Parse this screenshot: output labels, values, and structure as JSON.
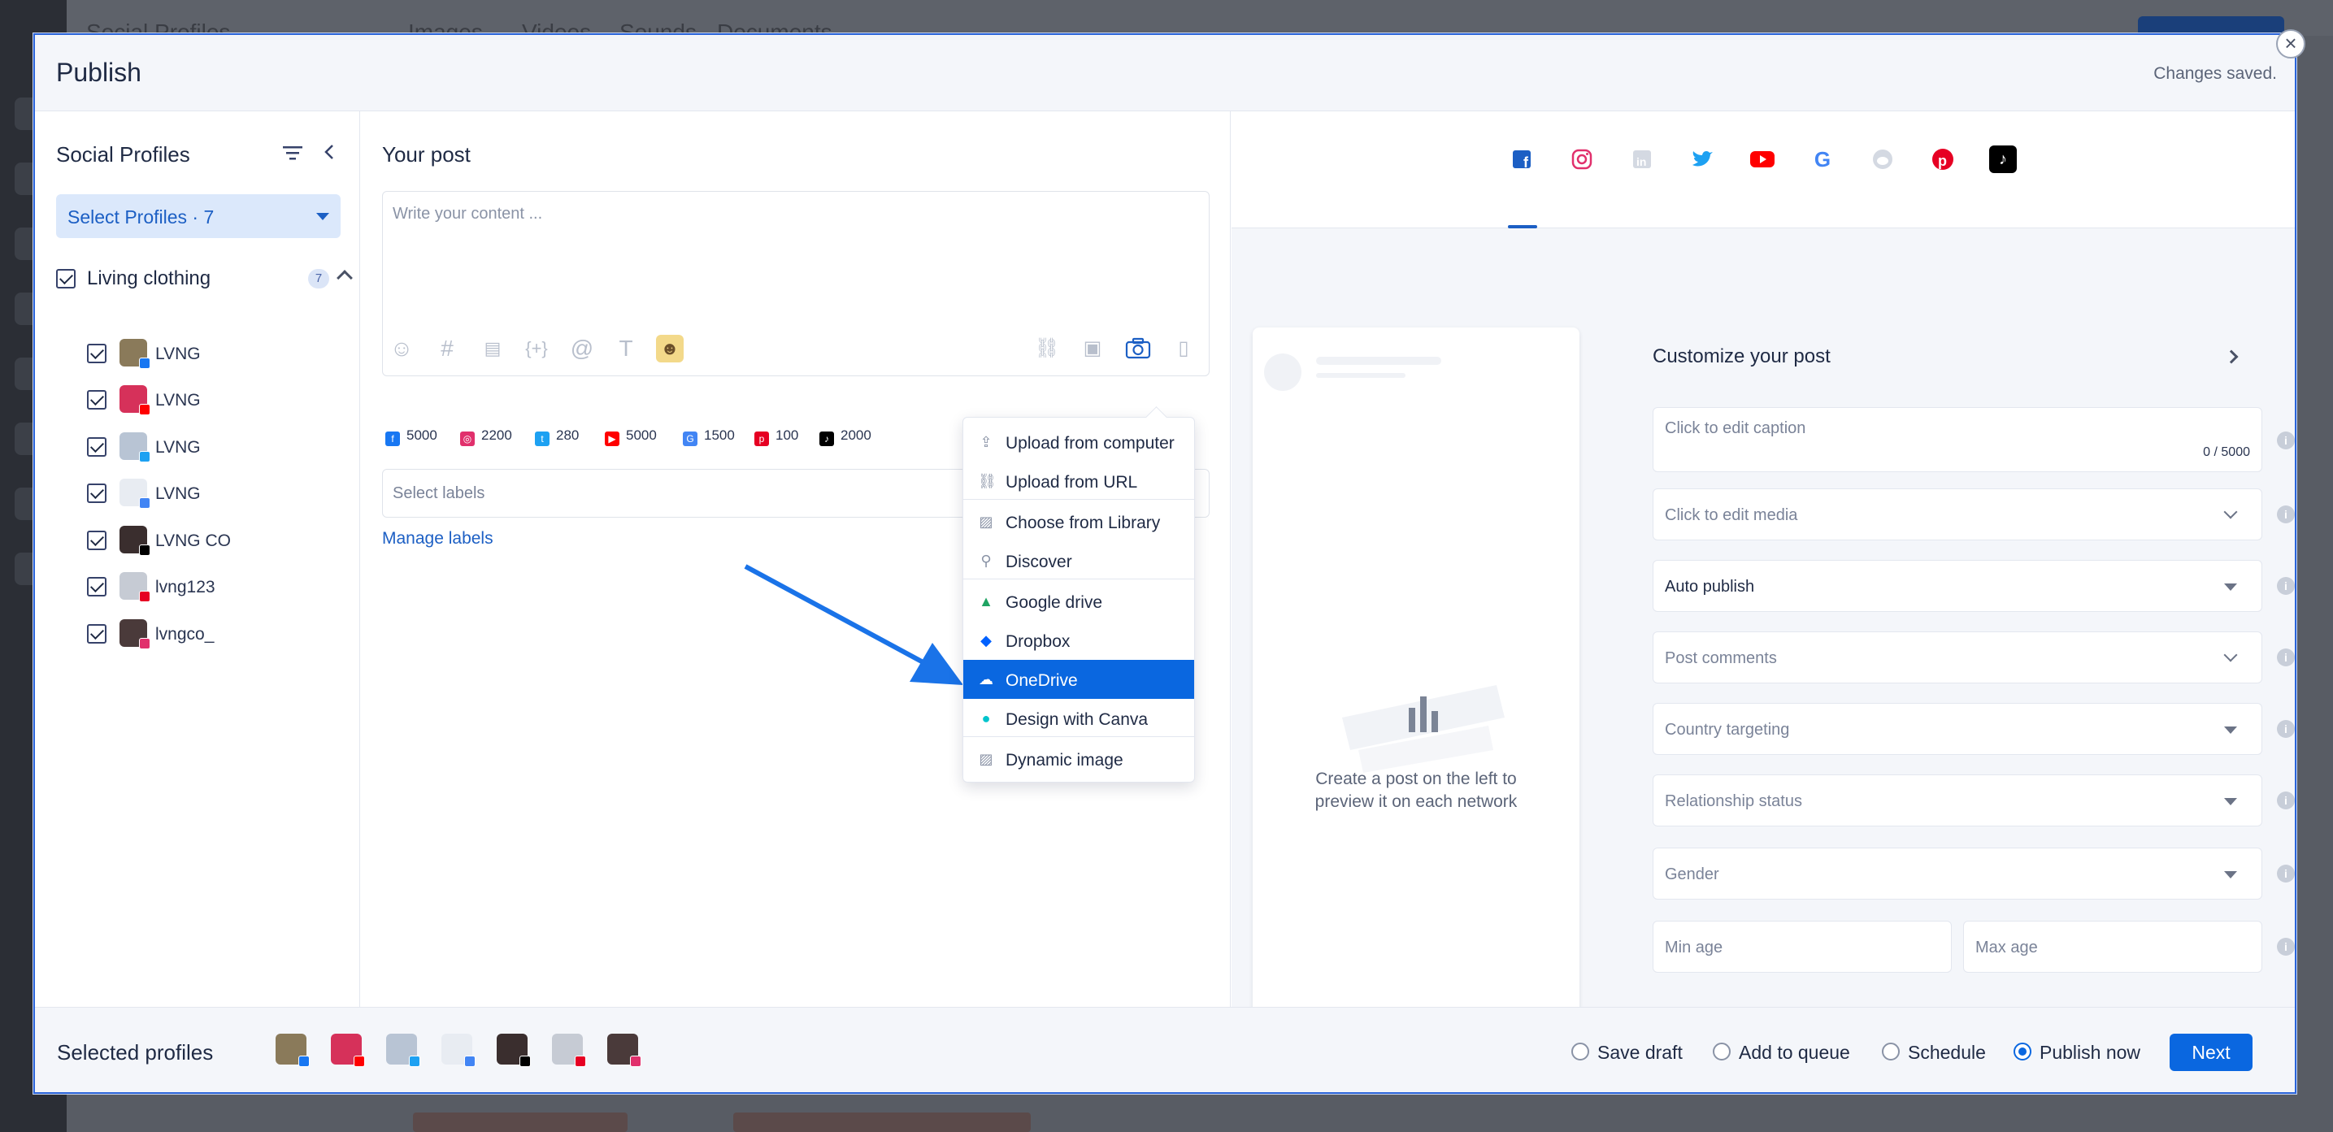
{
  "background": {
    "topbar_title": "Social Profiles",
    "topbar_tabs": [
      "Images",
      "Videos",
      "Sounds",
      "Documents"
    ]
  },
  "modal": {
    "title": "Publish",
    "status": "Changes saved."
  },
  "profiles_panel": {
    "title": "Social Profiles",
    "select_label": "Select Profiles · 7",
    "group": {
      "name": "Living clothing",
      "count": "7"
    },
    "items": [
      {
        "name": "LVNG",
        "network": "facebook",
        "avatar_color": "#8a7a5a",
        "badge_color": "#1877f2"
      },
      {
        "name": "LVNG",
        "network": "youtube",
        "avatar_color": "#d6315a",
        "badge_color": "#ff0000"
      },
      {
        "name": "LVNG",
        "network": "twitter",
        "avatar_color": "#b8c4d4",
        "badge_color": "#1da1f2"
      },
      {
        "name": "LVNG",
        "network": "google",
        "avatar_color": "#e8ecf2",
        "badge_color": "#4285f4"
      },
      {
        "name": "LVNG CO",
        "network": "tiktok",
        "avatar_color": "#3a2e2e",
        "badge_color": "#000000"
      },
      {
        "name": "lvng123",
        "network": "pinterest",
        "avatar_color": "#c6cbd4",
        "badge_color": "#e60023"
      },
      {
        "name": "lvngco_",
        "network": "instagram",
        "avatar_color": "#4a3a3a",
        "badge_color": "#e1306c"
      }
    ]
  },
  "post_panel": {
    "title": "Your post",
    "editor_placeholder": "Write your content ...",
    "limits": [
      {
        "network": "facebook",
        "value": "5000",
        "color": "#1877f2"
      },
      {
        "network": "instagram",
        "value": "2200",
        "color": "#e1306c"
      },
      {
        "network": "twitter",
        "value": "280",
        "color": "#1da1f2"
      },
      {
        "network": "youtube",
        "value": "5000",
        "color": "#ff0000"
      },
      {
        "network": "google",
        "value": "1500",
        "color": "#4285f4"
      },
      {
        "network": "pinterest",
        "value": "100",
        "color": "#e60023"
      },
      {
        "network": "tiktok",
        "value": "2000",
        "color": "#000000"
      }
    ],
    "labels_placeholder": "Select labels",
    "manage_labels": "Manage labels"
  },
  "upload_menu": {
    "items": [
      {
        "label": "Upload from computer",
        "icon": "upload-icon"
      },
      {
        "label": "Upload from URL",
        "icon": "link-icon"
      },
      {
        "label": "Choose from Library",
        "icon": "image-icon"
      },
      {
        "label": "Discover",
        "icon": "search-icon"
      },
      {
        "label": "Google drive",
        "icon": "google-drive-icon"
      },
      {
        "label": "Dropbox",
        "icon": "dropbox-icon"
      },
      {
        "label": "OneDrive",
        "icon": "onedrive-icon",
        "active": true
      },
      {
        "label": "Design with Canva",
        "icon": "canva-icon"
      },
      {
        "label": "Dynamic image",
        "icon": "image-icon"
      }
    ]
  },
  "preview": {
    "message": "Create a post on the left to preview it on each network",
    "active_network": "facebook"
  },
  "customize": {
    "title": "Customize your post",
    "caption_placeholder": "Click to edit caption",
    "caption_count": "0 / 5000",
    "media_placeholder": "Click to edit media",
    "auto_publish": "Auto publish",
    "post_comments": "Post comments",
    "country_targeting": "Country targeting",
    "relationship_status": "Relationship status",
    "gender": "Gender",
    "min_age": "Min age",
    "max_age": "Max age"
  },
  "footer": {
    "selected_profiles": "Selected profiles",
    "options": [
      {
        "label": "Save draft",
        "checked": false
      },
      {
        "label": "Add to queue",
        "checked": false
      },
      {
        "label": "Schedule",
        "checked": false
      },
      {
        "label": "Publish now",
        "checked": true
      }
    ],
    "next": "Next"
  },
  "colors": {
    "accent": "#0a67e0",
    "link": "#1c5fc4",
    "arrow": "#1a73e8"
  }
}
